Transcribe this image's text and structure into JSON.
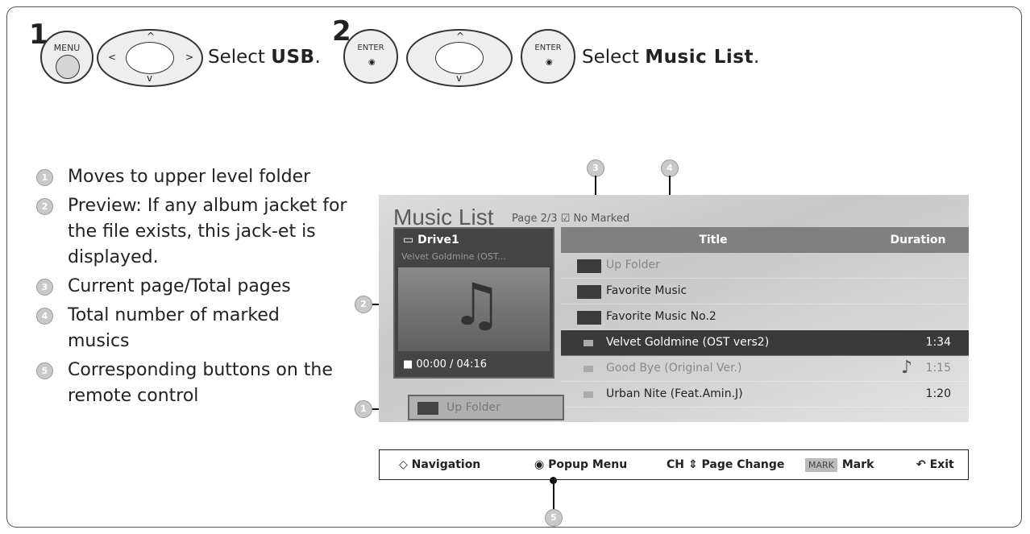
{
  "step1": {
    "number": "1",
    "menu_label": "MENU",
    "text_pre": "Select ",
    "text_bold": "USB",
    "text_post": "."
  },
  "step2": {
    "number": "2",
    "enter_label": "ENTER",
    "text_pre": "Select ",
    "text_bold": "Music List",
    "text_post": "."
  },
  "legend": [
    {
      "num": "1",
      "text": "Moves to upper level folder"
    },
    {
      "num": "2",
      "text": "Preview: If any album jacket for the file exists, this jack-et is displayed."
    },
    {
      "num": "3",
      "text": "Current page/Total pages"
    },
    {
      "num": "4",
      "text": "Total number of marked musics"
    },
    {
      "num": "5",
      "text": "Corresponding buttons on the remote control"
    }
  ],
  "callouts": {
    "c1": "1",
    "c2": "2",
    "c3": "3",
    "c4": "4",
    "c5": "5"
  },
  "screen": {
    "title": "Music List",
    "page_info": "Page 2/3 ☑ No Marked",
    "drive": "Drive1",
    "drive_sub": "Velvet Goldmine (OST...",
    "time": "■ 00:00 / 04:16",
    "up_folder_button": "Up Folder",
    "col_title": "Title",
    "col_duration": "Duration",
    "rows": [
      {
        "name": "Up Folder",
        "duration": ""
      },
      {
        "name": "Favorite Music",
        "duration": ""
      },
      {
        "name": "Favorite Music No.2",
        "duration": ""
      },
      {
        "name": "Velvet Goldmine (OST vers2)",
        "duration": "1:34"
      },
      {
        "name": "Good Bye (Original Ver.)",
        "duration": "1:15"
      },
      {
        "name": "Urban Nite (Feat.Amin.J)",
        "duration": "1:20"
      }
    ]
  },
  "guide": {
    "navigation": "Navigation",
    "popup": "Popup Menu",
    "ch": "CH",
    "page_change": "Page Change",
    "mark_key": "MARK",
    "mark": "Mark",
    "exit": "Exit"
  },
  "colors": {
    "selected_row": "#3a3a3a",
    "header": "#808080"
  }
}
